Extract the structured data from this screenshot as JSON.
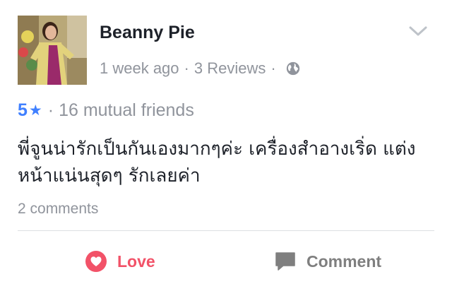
{
  "post": {
    "author_name": "Beanny Pie",
    "time_ago": "1 week ago",
    "reviews": "3 Reviews",
    "separator": "·",
    "privacy_icon": "globe-icon",
    "menu_icon": "chevron-down-icon",
    "rating_value": "5",
    "rating_icon": "star-icon",
    "mutual_friends": "16 mutual friends",
    "body_line1": "พี่จูนน่ารักเป็นกันเองมากๆค่ะ เครื่องสำอางเริ่ด แต่ง",
    "body_line2": "หน้าแน่นสุดๆ รักเลยค่า",
    "comments_count": "2 comments"
  },
  "actions": {
    "love_label": "Love",
    "love_icon": "heart-icon",
    "comment_label": "Comment",
    "comment_icon": "speech-bubble-icon"
  },
  "colors": {
    "love": "#f25268",
    "rating": "#4080ff",
    "meta": "#90949c",
    "text": "#1d2129"
  }
}
